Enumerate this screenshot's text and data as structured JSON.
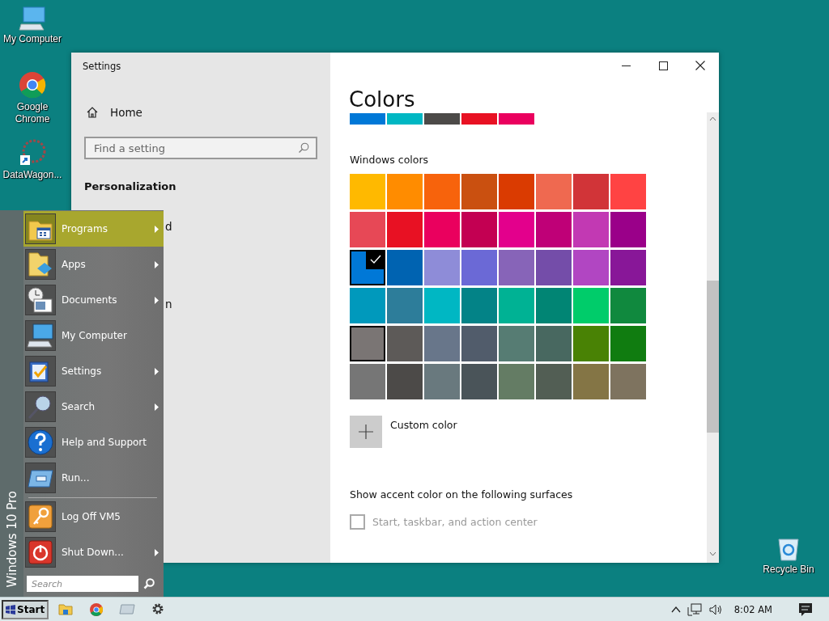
{
  "desktop_icons": [
    {
      "label": "My Computer"
    },
    {
      "label": "Google Chrome"
    },
    {
      "label": "DataWagon..."
    },
    {
      "label": "Recycle Bin"
    }
  ],
  "settings_window": {
    "app_title": "Settings",
    "home": "Home",
    "search": {
      "placeholder": "Find a setting"
    },
    "section": "Personalization",
    "nav_items": [
      {
        "label": "d"
      },
      {
        "label": "n"
      }
    ],
    "page_title": "Colors",
    "recent_colors": [
      {
        "color": "#0078d7"
      },
      {
        "color": "#00b7c3"
      },
      {
        "color": "#4c4a48"
      },
      {
        "color": "#e81123"
      },
      {
        "color": "#ea005e"
      }
    ],
    "windows_colors_label": "Windows colors",
    "swatches": [
      {
        "color": "#ffb900",
        "selected": false,
        "outlined": false
      },
      {
        "color": "#ff8c00",
        "selected": false,
        "outlined": false
      },
      {
        "color": "#f7630c",
        "selected": false,
        "outlined": false
      },
      {
        "color": "#ca5010",
        "selected": false,
        "outlined": false
      },
      {
        "color": "#da3b01",
        "selected": false,
        "outlined": false
      },
      {
        "color": "#ef6950",
        "selected": false,
        "outlined": false
      },
      {
        "color": "#d13438",
        "selected": false,
        "outlined": false
      },
      {
        "color": "#ff4343",
        "selected": false,
        "outlined": false
      },
      {
        "color": "#e74856",
        "selected": false,
        "outlined": false
      },
      {
        "color": "#e81123",
        "selected": false,
        "outlined": false
      },
      {
        "color": "#ea005e",
        "selected": false,
        "outlined": false
      },
      {
        "color": "#c30052",
        "selected": false,
        "outlined": false
      },
      {
        "color": "#e3008c",
        "selected": false,
        "outlined": false
      },
      {
        "color": "#bf0077",
        "selected": false,
        "outlined": false
      },
      {
        "color": "#c239b3",
        "selected": false,
        "outlined": false
      },
      {
        "color": "#9a0089",
        "selected": false,
        "outlined": false
      },
      {
        "color": "#0078d7",
        "selected": true,
        "outlined": false
      },
      {
        "color": "#0063b1",
        "selected": false,
        "outlined": false
      },
      {
        "color": "#8e8cd8",
        "selected": false,
        "outlined": false
      },
      {
        "color": "#6b69d6",
        "selected": false,
        "outlined": false
      },
      {
        "color": "#8764b8",
        "selected": false,
        "outlined": false
      },
      {
        "color": "#744da9",
        "selected": false,
        "outlined": false
      },
      {
        "color": "#b146c2",
        "selected": false,
        "outlined": false
      },
      {
        "color": "#881798",
        "selected": false,
        "outlined": false
      },
      {
        "color": "#0099bc",
        "selected": false,
        "outlined": false
      },
      {
        "color": "#2d7d9a",
        "selected": false,
        "outlined": false
      },
      {
        "color": "#00b7c3",
        "selected": false,
        "outlined": false
      },
      {
        "color": "#038387",
        "selected": false,
        "outlined": false
      },
      {
        "color": "#00b294",
        "selected": false,
        "outlined": false
      },
      {
        "color": "#018574",
        "selected": false,
        "outlined": false
      },
      {
        "color": "#00cc6a",
        "selected": false,
        "outlined": false
      },
      {
        "color": "#10893e",
        "selected": false,
        "outlined": false
      },
      {
        "color": "#7a7574",
        "selected": false,
        "outlined": true
      },
      {
        "color": "#5d5a58",
        "selected": false,
        "outlined": false
      },
      {
        "color": "#68768a",
        "selected": false,
        "outlined": false
      },
      {
        "color": "#515c6b",
        "selected": false,
        "outlined": false
      },
      {
        "color": "#567c73",
        "selected": false,
        "outlined": false
      },
      {
        "color": "#486860",
        "selected": false,
        "outlined": false
      },
      {
        "color": "#498205",
        "selected": false,
        "outlined": false
      },
      {
        "color": "#107c10",
        "selected": false,
        "outlined": false
      },
      {
        "color": "#767676",
        "selected": false,
        "outlined": false
      },
      {
        "color": "#4c4a48",
        "selected": false,
        "outlined": false
      },
      {
        "color": "#69797e",
        "selected": false,
        "outlined": false
      },
      {
        "color": "#4a5459",
        "selected": false,
        "outlined": false
      },
      {
        "color": "#647c64",
        "selected": false,
        "outlined": false
      },
      {
        "color": "#525e54",
        "selected": false,
        "outlined": false
      },
      {
        "color": "#847545",
        "selected": false,
        "outlined": false
      },
      {
        "color": "#7e735f",
        "selected": false,
        "outlined": false
      }
    ],
    "custom_color": "Custom color",
    "surfaces_heading": "Show accent color on the following surfaces",
    "surface_options": [
      {
        "label": "Start, taskbar, and action center",
        "checked": false,
        "disabled": true
      }
    ]
  },
  "start_menu": {
    "side_label": "Windows 10 Pro",
    "items": [
      {
        "label": "Programs",
        "has_submenu": true,
        "selected": true,
        "separator_before": false
      },
      {
        "label": "Apps",
        "has_submenu": true,
        "selected": false,
        "separator_before": false
      },
      {
        "label": "Documents",
        "has_submenu": true,
        "selected": false,
        "separator_before": false
      },
      {
        "label": "My Computer",
        "has_submenu": false,
        "selected": false,
        "separator_before": false
      },
      {
        "label": "Settings",
        "has_submenu": true,
        "selected": false,
        "separator_before": false
      },
      {
        "label": "Search",
        "has_submenu": true,
        "selected": false,
        "separator_before": false
      },
      {
        "label": "Help and Support",
        "has_submenu": false,
        "selected": false,
        "separator_before": false
      },
      {
        "label": "Run...",
        "has_submenu": false,
        "selected": false,
        "separator_before": false
      },
      {
        "label": "Log Off VM5",
        "has_submenu": false,
        "selected": false,
        "separator_before": true
      },
      {
        "label": "Shut Down...",
        "has_submenu": true,
        "selected": false,
        "separator_before": false
      }
    ],
    "search": {
      "placeholder": "Search"
    }
  },
  "taskbar": {
    "start_label": "Start",
    "clock": "8:02 AM"
  }
}
